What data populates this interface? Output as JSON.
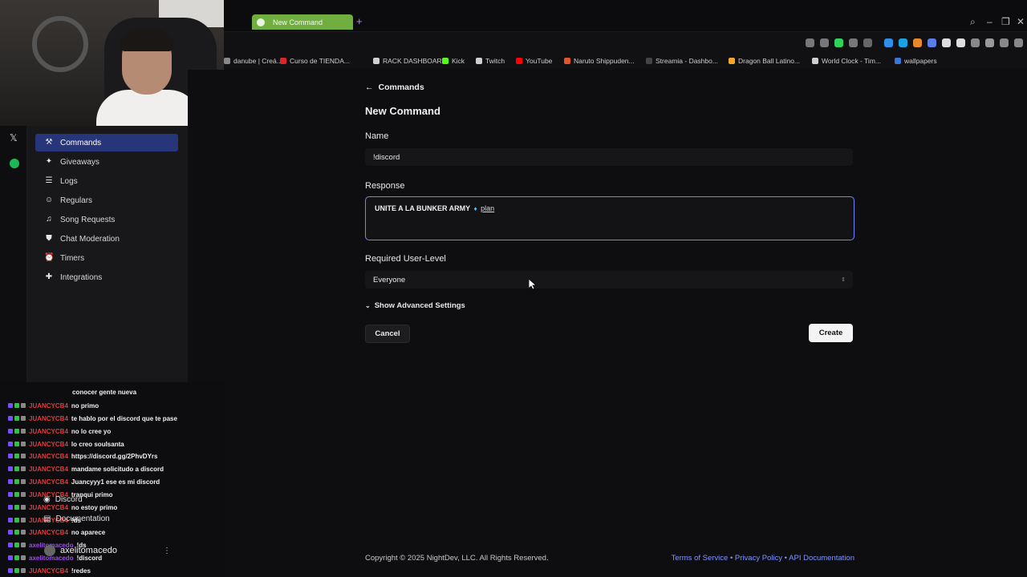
{
  "browser": {
    "active_tab": "New Command",
    "bookmarks": [
      {
        "label": "danube | Creá...",
        "color": "#888888"
      },
      {
        "label": "Curso de TIENDA...",
        "color": "#e0242e"
      },
      {
        "label": "RACK DASHBOARD",
        "color": "#cfcfcf"
      },
      {
        "label": "Kick",
        "color": "#53fc18"
      },
      {
        "label": "Twitch",
        "color": "#cfcfcf"
      },
      {
        "label": "YouTube",
        "color": "#ff0000"
      },
      {
        "label": "Naruto Shippuden...",
        "color": "#e8542a"
      },
      {
        "label": "Streamia - Dashbo...",
        "color": "#444444"
      },
      {
        "label": "Dragon Ball Latino...",
        "color": "#f4a62a"
      },
      {
        "label": "World Clock - Tim...",
        "color": "#cfcfcf"
      },
      {
        "label": "wallpapers",
        "color": "#3a76d8"
      }
    ]
  },
  "sidebar": {
    "items": [
      {
        "label": "Commands",
        "icon": "wand-icon",
        "glyph": "⚒",
        "active": true
      },
      {
        "label": "Giveaways",
        "icon": "party-icon",
        "glyph": "✦",
        "active": false
      },
      {
        "label": "Logs",
        "icon": "list-icon",
        "glyph": "☰",
        "active": false
      },
      {
        "label": "Regulars",
        "icon": "users-icon",
        "glyph": "☺",
        "active": false
      },
      {
        "label": "Song Requests",
        "icon": "headphones-icon",
        "glyph": "♫",
        "active": false
      },
      {
        "label": "Chat Moderation",
        "icon": "shield-icon",
        "glyph": "⛊",
        "active": false
      },
      {
        "label": "Timers",
        "icon": "alarm-icon",
        "glyph": "⏰",
        "active": false
      },
      {
        "label": "Integrations",
        "icon": "puzzle-icon",
        "glyph": "✚",
        "active": false
      }
    ]
  },
  "chat": {
    "messages": [
      {
        "user": "JUANCYCB4",
        "text": "no primo"
      },
      {
        "user": "JUANCYCB4",
        "text": "te hablo por el discord que te pase"
      },
      {
        "user": "JUANCYCB4",
        "text": "no lo cree yo"
      },
      {
        "user": "JUANCYCB4",
        "text": "lo creo soulsanta"
      },
      {
        "user": "JUANCYCB4",
        "text": "https://discord.gg/2PhvDYrs"
      },
      {
        "user": "JUANCYCB4",
        "text": "mandame solicitudo a discord"
      },
      {
        "user": "JUANCYCB4",
        "text": "Juancyyy1 ese es mi discord"
      },
      {
        "user": "JUANCYCB4",
        "text": "tranqui primo"
      },
      {
        "user": "JUANCYCB4",
        "text": "no estoy primo"
      },
      {
        "user": "JUANCYCB4",
        "text": "!ds"
      },
      {
        "user": "JUANCYCB4",
        "text": "no aparece"
      },
      {
        "user": "axelitomacedo",
        "text": "!ds"
      },
      {
        "user": "axelitomacedo",
        "text": "!discord"
      },
      {
        "user": "JUANCYCB4",
        "text": "!redes"
      }
    ],
    "partial_text": "conocer gente nueva",
    "overlay_discord": "Discord",
    "overlay_docs": "Documentation",
    "current_user": "axelitomacedo"
  },
  "form": {
    "back_label": "Commands",
    "title": "New Command",
    "name_label": "Name",
    "name_value": "!discord",
    "response_label": "Response",
    "response_value": "UNITE A LA BUNKER ARMY",
    "response_link": "plan",
    "userlevel_label": "Required User-Level",
    "userlevel_value": "Everyone",
    "advanced_label": "Show Advanced Settings",
    "cancel_label": "Cancel",
    "create_label": "Create"
  },
  "footer": {
    "copyright": "Copyright © 2025 NightDev, LLC. All Rights Reserved.",
    "terms": "Terms of Service",
    "privacy": "Privacy Policy",
    "api": "API Documentation"
  }
}
